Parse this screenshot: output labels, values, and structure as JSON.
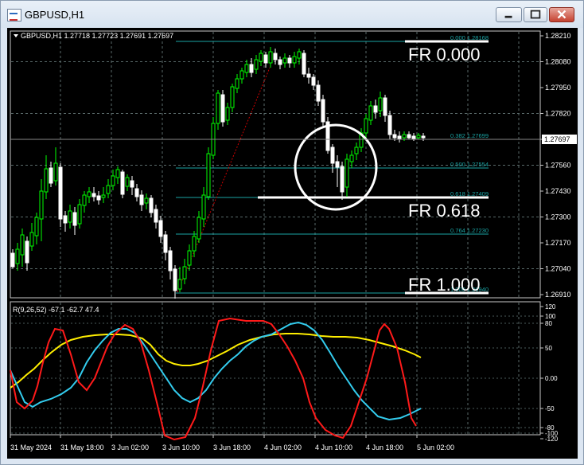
{
  "window": {
    "title": "GBPUSD,H1"
  },
  "main_chart": {
    "header": "GBPUSD,H1  1.27718 1.27723 1.27691 1.27697",
    "current_price": "1.27697",
    "price_labels": [
      "1.28210",
      "1.28080",
      "1.27950",
      "1.27820",
      "1.27690",
      "1.27560",
      "1.27430",
      "1.27300",
      "1.27170",
      "1.27040",
      "1.26910"
    ]
  },
  "fib_levels": [
    {
      "label": "0.000  1.28168",
      "big": "FR 0.000"
    },
    {
      "label": "0.382  1.27699",
      "big": ""
    },
    {
      "label": "0.500  1.27554",
      "big": ""
    },
    {
      "label": "0.618  1.27409",
      "big": "FR 0.618"
    },
    {
      "label": "0.764  1.27230",
      "big": ""
    },
    {
      "label": "1.000  1.26940",
      "big": "FR 1.000"
    }
  ],
  "indicator": {
    "header": "R(9,26,52) -67.1 -62.7 47.4",
    "scale_labels": [
      "120",
      "100",
      "80",
      "50",
      "0.00",
      "-50",
      "-80",
      "-100",
      "-120"
    ],
    "colors": {
      "fast": "#ff1a1a",
      "mid": "#33ccee",
      "slow": "#ffee00"
    }
  },
  "time_labels": [
    "31 May 2024",
    "31 May 18:00",
    "3 Jun 02:00",
    "3 Jun 10:00",
    "3 Jun 18:00",
    "4 Jun 02:00",
    "4 Jun 10:00",
    "4 Jun 18:00",
    "5 Jun 02:00"
  ],
  "colors": {
    "bull": "#00ff00",
    "bear": "#ffffff",
    "fib": "#1aa3a3",
    "grid": "#5a6a6a"
  }
}
